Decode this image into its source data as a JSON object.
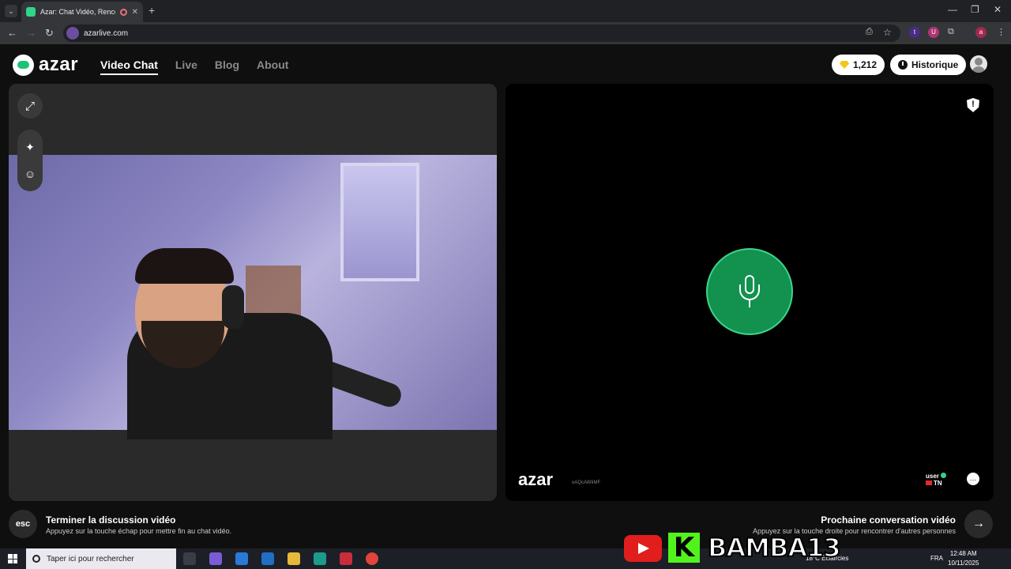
{
  "browser": {
    "tab_title": "Azar: Chat Vidéo, Rencontre",
    "tab_close": "✕",
    "new_tab": "+",
    "url": "azarlive.com",
    "window_controls": [
      "—",
      "❐",
      "✕"
    ]
  },
  "app": {
    "logo": "azar",
    "nav": [
      "Video Chat",
      "Live",
      "Blog",
      "About"
    ],
    "active_nav": "Video Chat",
    "gems": "1,212",
    "history_label": "Historique",
    "watermark": "azar",
    "watermark_id": "oAQcAWIiMF",
    "peer_name": "user",
    "peer_country": "TN",
    "accent_color": "#12914f"
  },
  "footer": {
    "esc_key": "esc",
    "end_title": "Terminer la discussion vidéo",
    "end_sub": "Appuyez sur la touche échap pour mettre fin au chat vidéo.",
    "next_title": "Prochaine conversation vidéo",
    "next_sub": "Appuyez sur la touche droite pour rencontrer d'autres personnes",
    "next_arrow": "→"
  },
  "taskbar": {
    "search_placeholder": "Taper ici pour rechercher",
    "weather": "18°C  Éclaircies",
    "language": "FRA",
    "time": "12:48 AM",
    "date": "10/11/2025"
  },
  "overlay": {
    "streamer": "BAMBA13",
    "kick_letter": "K"
  }
}
